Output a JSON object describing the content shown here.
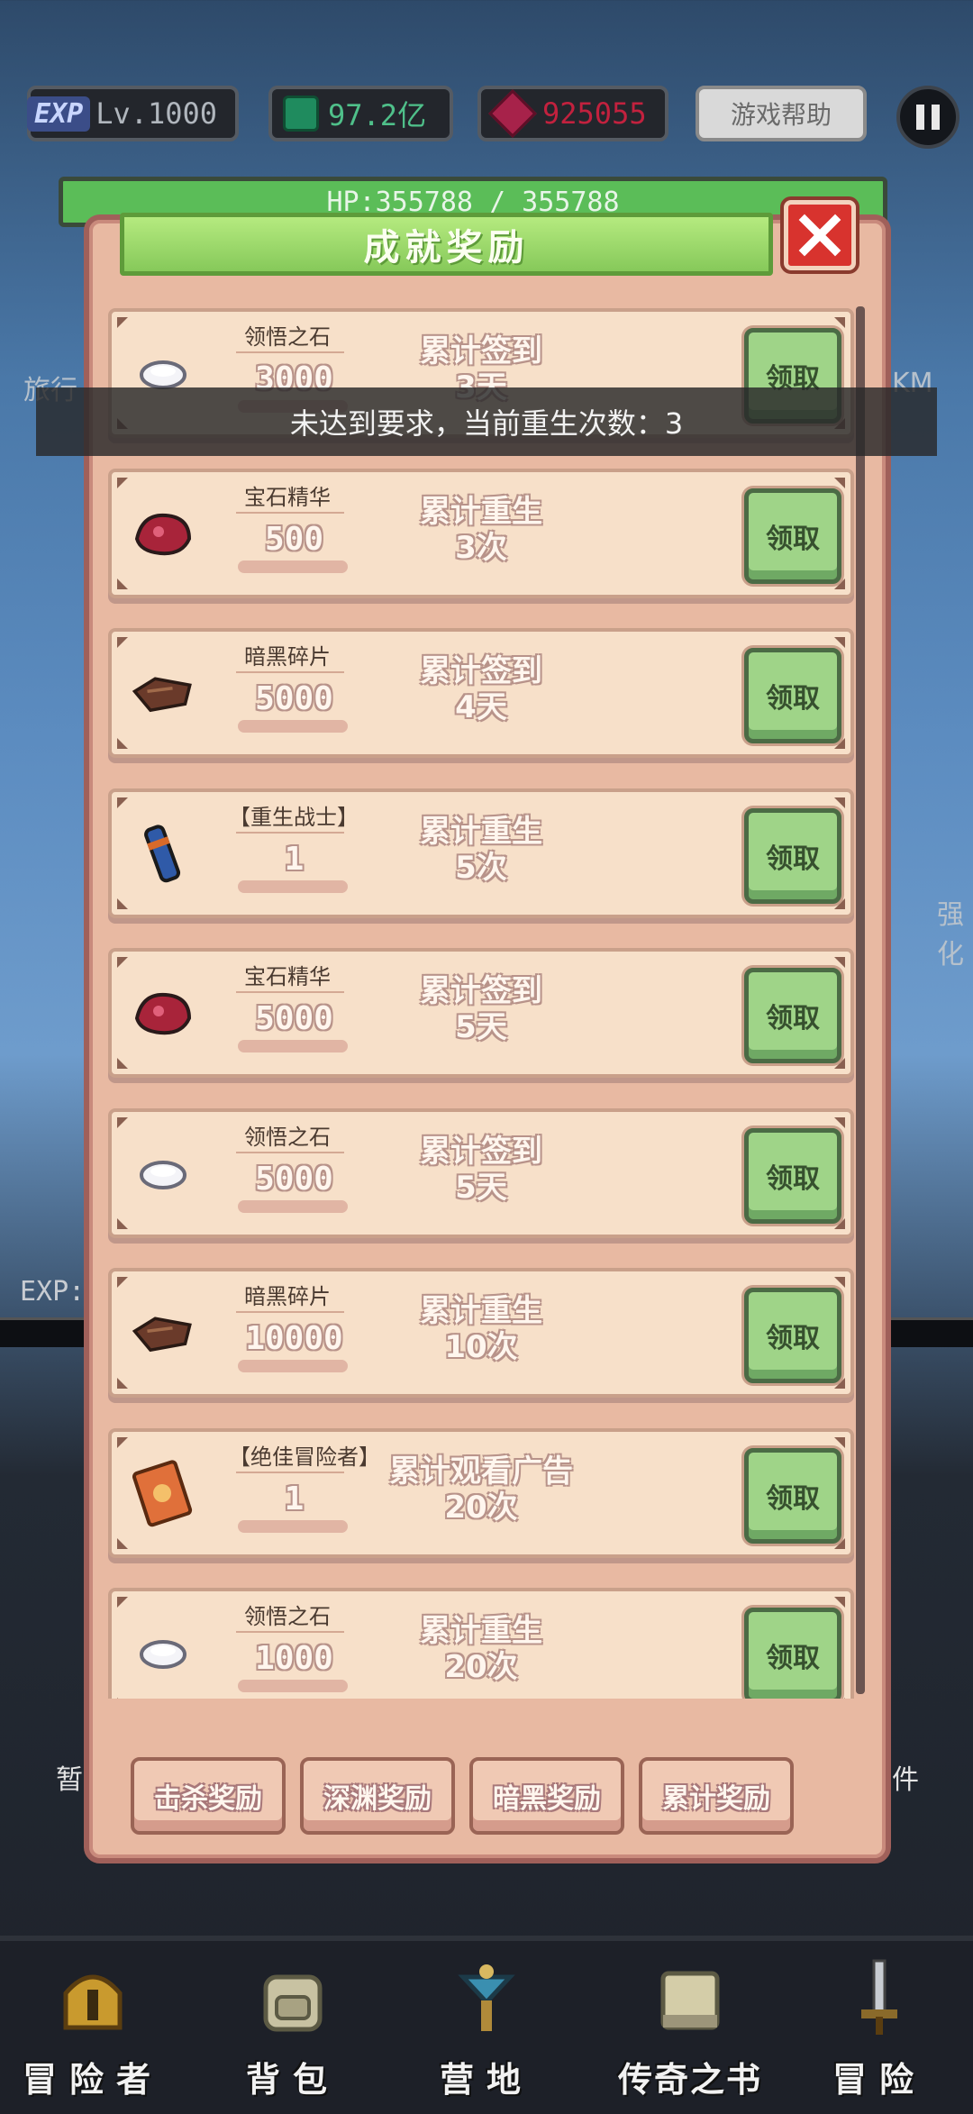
{
  "hud": {
    "exp_badge": "EXP",
    "level": "Lv.1000",
    "green_currency": "97.2亿",
    "red_currency": "925055",
    "help_label": "游戏帮助"
  },
  "hp": "HP:355788 / 355788",
  "background": {
    "left_text": "旅行",
    "right_text": "KM",
    "side_text": "强化",
    "exp_label": "EXP:",
    "left_small": "暂",
    "right_small": "件"
  },
  "dialog": {
    "title": "成就奖励",
    "rewards": [
      {
        "item": "领悟之石",
        "qty": "3000",
        "goal_line1": "累计签到",
        "goal_line2": "3天",
        "claim": "领取",
        "icon": "white-stone-icon"
      },
      {
        "item": "宝石精华",
        "qty": "500",
        "goal_line1": "累计重生",
        "goal_line2": "3次",
        "claim": "领取",
        "icon": "red-gem-icon"
      },
      {
        "item": "暗黑碎片",
        "qty": "5000",
        "goal_line1": "累计签到",
        "goal_line2": "4天",
        "claim": "领取",
        "icon": "dark-shard-icon"
      },
      {
        "item": "【重生战士】",
        "qty": "1",
        "goal_line1": "累计重生",
        "goal_line2": "5次",
        "claim": "领取",
        "icon": "scroll-icon"
      },
      {
        "item": "宝石精华",
        "qty": "5000",
        "goal_line1": "累计签到",
        "goal_line2": "5天",
        "claim": "领取",
        "icon": "red-gem-icon"
      },
      {
        "item": "领悟之石",
        "qty": "5000",
        "goal_line1": "累计签到",
        "goal_line2": "5天",
        "claim": "领取",
        "icon": "white-stone-icon"
      },
      {
        "item": "暗黑碎片",
        "qty": "10000",
        "goal_line1": "累计重生",
        "goal_line2": "10次",
        "claim": "领取",
        "icon": "dark-shard-icon"
      },
      {
        "item": "【绝佳冒险者】",
        "qty": "1",
        "goal_line1": "累计观看广告",
        "goal_line2": "20次",
        "claim": "领取",
        "icon": "card-icon"
      },
      {
        "item": "领悟之石",
        "qty": "1000",
        "goal_line1": "累计重生",
        "goal_line2": "20次",
        "claim": "领取",
        "icon": "white-stone-icon"
      }
    ],
    "tabs": [
      "击杀奖励",
      "深渊奖励",
      "暗黑奖励",
      "累计奖励"
    ]
  },
  "toast": "未达到要求，当前重生次数：3",
  "nav": [
    "冒险者",
    "背包",
    "营地",
    "传奇之书",
    "冒险"
  ]
}
